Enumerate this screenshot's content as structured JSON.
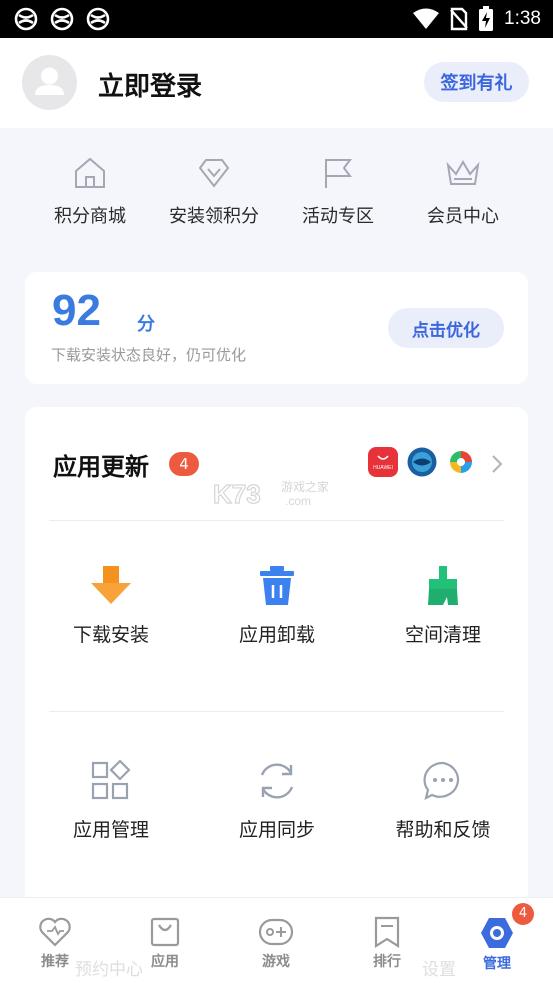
{
  "status_bar": {
    "time": "1:38",
    "icons": [
      "app-notification-icon",
      "app-notification-icon",
      "app-notification-icon",
      "wifi-icon",
      "no-sim-icon",
      "battery-charging-icon"
    ]
  },
  "header": {
    "title": "立即登录",
    "checkin_label": "签到有礼"
  },
  "quick_entries": [
    {
      "label": "积分商城",
      "icon": "house-icon"
    },
    {
      "label": "安装领积分",
      "icon": "diamond-icon"
    },
    {
      "label": "活动专区",
      "icon": "flag-icon"
    },
    {
      "label": "会员中心",
      "icon": "crown-icon"
    }
  ],
  "score": {
    "value": "92",
    "unit": "分",
    "description": "下载安装状态良好，仍可优化",
    "button_label": "点击优化"
  },
  "updates": {
    "title": "应用更新",
    "count": "4",
    "app_icons": [
      "huawei-appgallery-icon",
      "globe-app-icon",
      "color-ring-app-icon"
    ],
    "huawei_text": "HUAWEI",
    "watermark_text": "K73",
    "watermark_sub": "游戏之家",
    "watermark_domain": ".com"
  },
  "tools": [
    {
      "label": "下载安装",
      "icon": "download-icon",
      "color": "#f5921e"
    },
    {
      "label": "应用卸载",
      "icon": "trash-icon",
      "color": "#3b82f0"
    },
    {
      "label": "空间清理",
      "icon": "broom-icon",
      "color": "#23c07a"
    },
    {
      "label": "应用管理",
      "icon": "app-grid-icon",
      "color": "#9aa2b1"
    },
    {
      "label": "应用同步",
      "icon": "sync-icon",
      "color": "#9aa2b1"
    },
    {
      "label": "帮助和反馈",
      "icon": "chat-bubble-icon",
      "color": "#9aa2b1"
    }
  ],
  "ghost_labels": [
    "预约中心",
    "设置"
  ],
  "bottom_nav": [
    {
      "label": "推荐",
      "icon": "heart-icon",
      "active": false
    },
    {
      "label": "应用",
      "icon": "shopping-bag-icon",
      "active": false
    },
    {
      "label": "游戏",
      "icon": "gamepad-icon",
      "active": false
    },
    {
      "label": "排行",
      "icon": "bookmark-icon",
      "active": false
    },
    {
      "label": "管理",
      "icon": "hexagon-gear-icon",
      "active": true
    }
  ],
  "nav_badge": "4",
  "colors": {
    "accent": "#3c66dc",
    "score": "#3a7be0",
    "badge": "#ee5a3f"
  }
}
